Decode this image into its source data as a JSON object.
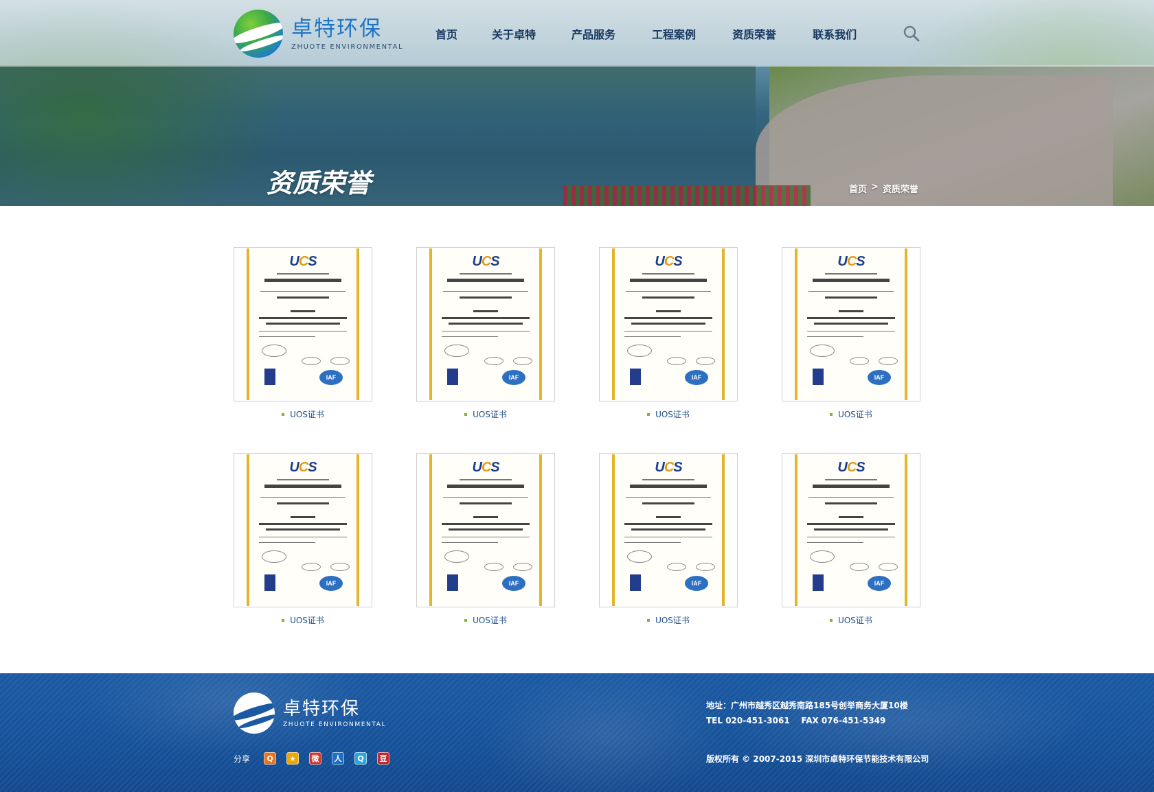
{
  "brand": {
    "name_cn": "卓特环保",
    "name_en": "ZHUOTE ENVIRONMENTAL"
  },
  "nav": {
    "items": [
      {
        "label": "首页"
      },
      {
        "label": "关于卓特"
      },
      {
        "label": "产品服务"
      },
      {
        "label": "工程案例"
      },
      {
        "label": "资质荣誉"
      },
      {
        "label": "联系我们"
      }
    ]
  },
  "hero": {
    "title": "资质荣誉"
  },
  "breadcrumb": {
    "home": "首页",
    "separator": ">",
    "current": "资质荣誉"
  },
  "certificates": {
    "items": [
      {
        "caption": "UOS证书"
      },
      {
        "caption": "UOS证书"
      },
      {
        "caption": "UOS证书"
      },
      {
        "caption": "UOS证书"
      },
      {
        "caption": "UOS证书"
      },
      {
        "caption": "UOS证书"
      },
      {
        "caption": "UOS证书"
      },
      {
        "caption": "UOS证书"
      }
    ]
  },
  "footer": {
    "address": "地址：广州市越秀区越秀南路185号创举商务大厦10楼",
    "phone": "TEL 020-451-3061    FAX 076-451-5349",
    "copyright": "版权所有 © 2007-2015 深圳市卓特环保节能技术有限公司",
    "share_label": "分享",
    "share_icons": [
      {
        "name": "qzone-icon",
        "glyph": "Q",
        "color": "#e8731a"
      },
      {
        "name": "favorite-star-icon",
        "glyph": "★",
        "color": "#f0a500"
      },
      {
        "name": "weibo-icon",
        "glyph": "微",
        "color": "#d6352b"
      },
      {
        "name": "renren-icon",
        "glyph": "人",
        "color": "#1c6fc7"
      },
      {
        "name": "qq-weibo-icon",
        "glyph": "Q",
        "color": "#2aa8d9"
      },
      {
        "name": "douban-icon",
        "glyph": "豆",
        "color": "#c9262b"
      }
    ]
  },
  "colors": {
    "brand_blue": "#1f74c4",
    "nav_text": "#16375f",
    "accent_green": "#7dbb2c",
    "footer_blue": "#1b5aa3"
  }
}
